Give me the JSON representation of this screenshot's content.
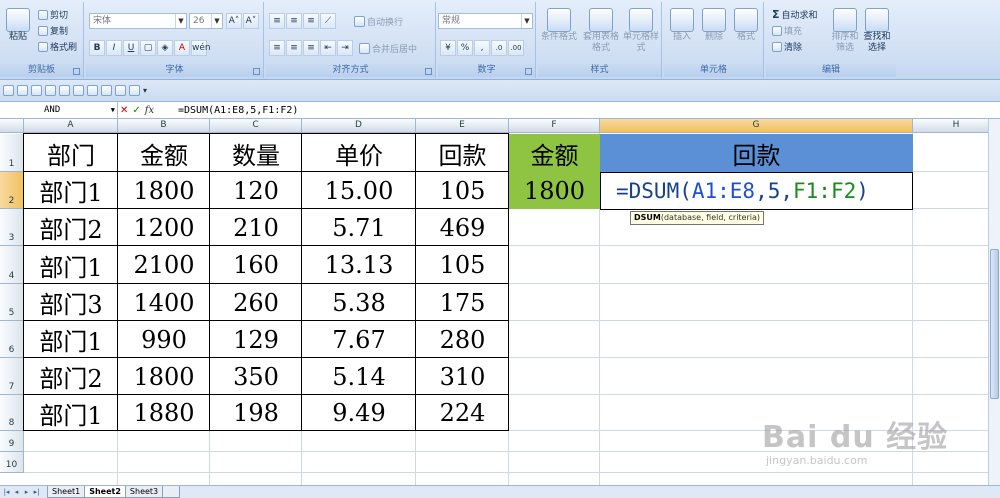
{
  "ribbon": {
    "clipboard": {
      "paste": "粘贴",
      "cut": "剪切",
      "copy": "复制",
      "format_painter": "格式刷",
      "label": "剪贴板"
    },
    "font": {
      "name": "宋体",
      "size": "26",
      "label": "字体",
      "bold": "B",
      "italic": "I",
      "underline": "U",
      "grow": "A˄",
      "shrink": "A˅",
      "color": "A"
    },
    "alignment": {
      "wrap": "自动换行",
      "merge": "合并后居中",
      "label": "对齐方式"
    },
    "number": {
      "format": "常规",
      "label": "数字",
      "currency": "¥",
      "percent": "%",
      "comma": ","
    },
    "styles": {
      "conditional": "条件格式",
      "table": "套用表格格式",
      "cell": "单元格样式",
      "label": "样式"
    },
    "cells": {
      "insert": "插入",
      "delete": "删除",
      "format": "格式",
      "label": "单元格"
    },
    "editing": {
      "autosum": "自动求和",
      "fill": "填充",
      "clear": "清除",
      "sort": "排序和筛选",
      "find": "查找和选择",
      "label": "编辑"
    }
  },
  "formula_bar": {
    "name_box": "AND",
    "formula": "=DSUM(A1:E8,5,F1:F2)"
  },
  "columns": [
    "A",
    "B",
    "C",
    "D",
    "E",
    "F",
    "G",
    "H"
  ],
  "rows": [
    "1",
    "2",
    "3",
    "4",
    "5",
    "6",
    "7",
    "8",
    "9",
    "10"
  ],
  "table": {
    "headers": [
      "部门",
      "金额",
      "数量",
      "单价",
      "回款"
    ],
    "rows": [
      [
        "部门1",
        "1800",
        "120",
        "15.00",
        "105"
      ],
      [
        "部门2",
        "1200",
        "210",
        "5.71",
        "469"
      ],
      [
        "部门1",
        "2100",
        "160",
        "13.13",
        "105"
      ],
      [
        "部门3",
        "1400",
        "260",
        "5.38",
        "175"
      ],
      [
        "部门1",
        "990",
        "129",
        "7.67",
        "280"
      ],
      [
        "部门2",
        "1800",
        "350",
        "5.14",
        "310"
      ],
      [
        "部门1",
        "1880",
        "198",
        "9.49",
        "224"
      ]
    ]
  },
  "criteria": {
    "f1": "金额",
    "f2": "1800",
    "g1": "回款"
  },
  "formula_cell": {
    "prefix": "=DSUM(",
    "ref1": "A1:E8",
    "mid": ",5,",
    "ref2": "F1:F2",
    "suffix": ")"
  },
  "tooltip": {
    "fn": "DSUM",
    "args": "(database, field, criteria)"
  },
  "sheets": [
    "Sheet1",
    "Sheet2",
    "Sheet3"
  ],
  "watermark": {
    "brand": "Bai du 经验",
    "url": "jingyan.baidu.com"
  },
  "colors": {
    "green_header": "#8ec442",
    "blue_header": "#5b8fd6",
    "ref1": "#1f4fd1",
    "ref2": "#1a8a1a"
  }
}
